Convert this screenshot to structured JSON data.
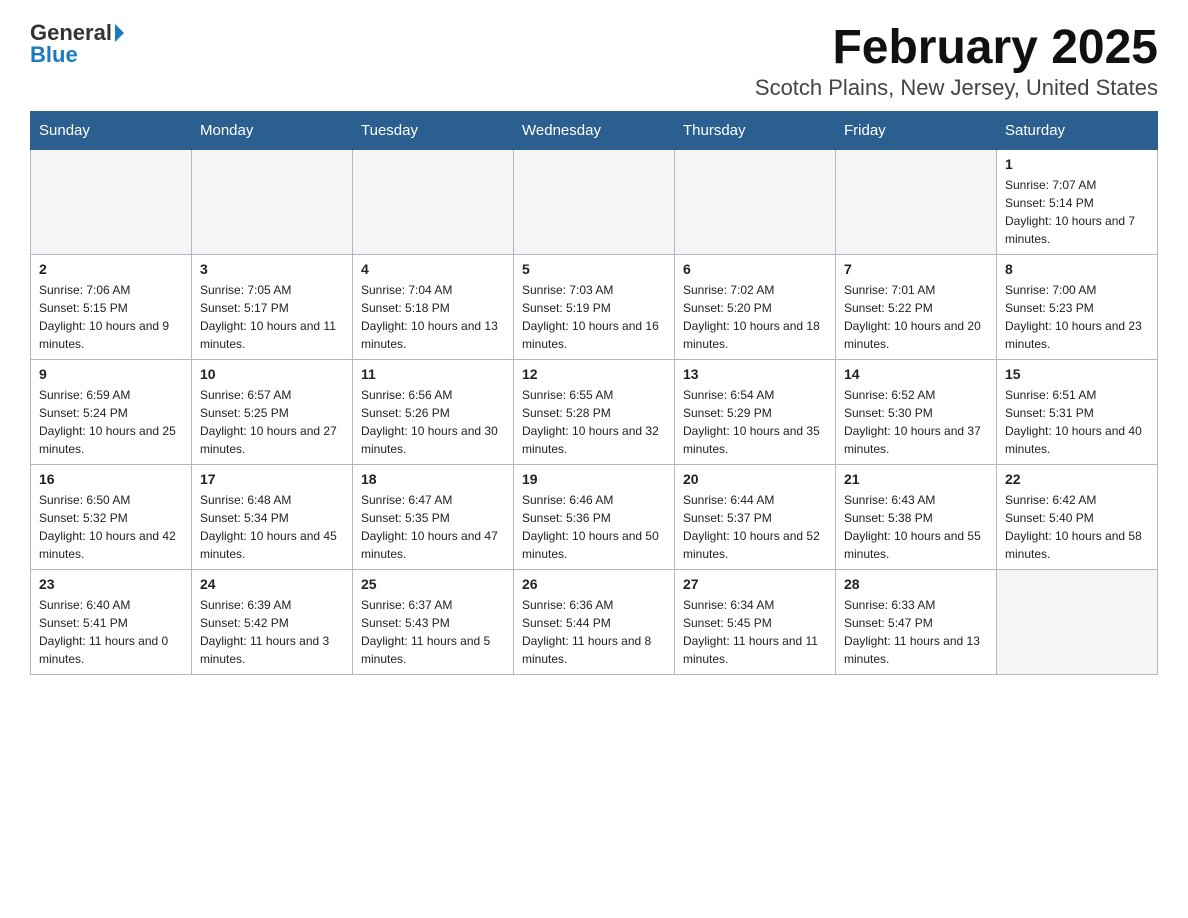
{
  "header": {
    "logo_general": "General",
    "logo_blue": "Blue",
    "main_title": "February 2025",
    "subtitle": "Scotch Plains, New Jersey, United States"
  },
  "days_of_week": [
    "Sunday",
    "Monday",
    "Tuesday",
    "Wednesday",
    "Thursday",
    "Friday",
    "Saturday"
  ],
  "weeks": [
    [
      {
        "day": "",
        "info": ""
      },
      {
        "day": "",
        "info": ""
      },
      {
        "day": "",
        "info": ""
      },
      {
        "day": "",
        "info": ""
      },
      {
        "day": "",
        "info": ""
      },
      {
        "day": "",
        "info": ""
      },
      {
        "day": "1",
        "info": "Sunrise: 7:07 AM\nSunset: 5:14 PM\nDaylight: 10 hours and 7 minutes."
      }
    ],
    [
      {
        "day": "2",
        "info": "Sunrise: 7:06 AM\nSunset: 5:15 PM\nDaylight: 10 hours and 9 minutes."
      },
      {
        "day": "3",
        "info": "Sunrise: 7:05 AM\nSunset: 5:17 PM\nDaylight: 10 hours and 11 minutes."
      },
      {
        "day": "4",
        "info": "Sunrise: 7:04 AM\nSunset: 5:18 PM\nDaylight: 10 hours and 13 minutes."
      },
      {
        "day": "5",
        "info": "Sunrise: 7:03 AM\nSunset: 5:19 PM\nDaylight: 10 hours and 16 minutes."
      },
      {
        "day": "6",
        "info": "Sunrise: 7:02 AM\nSunset: 5:20 PM\nDaylight: 10 hours and 18 minutes."
      },
      {
        "day": "7",
        "info": "Sunrise: 7:01 AM\nSunset: 5:22 PM\nDaylight: 10 hours and 20 minutes."
      },
      {
        "day": "8",
        "info": "Sunrise: 7:00 AM\nSunset: 5:23 PM\nDaylight: 10 hours and 23 minutes."
      }
    ],
    [
      {
        "day": "9",
        "info": "Sunrise: 6:59 AM\nSunset: 5:24 PM\nDaylight: 10 hours and 25 minutes."
      },
      {
        "day": "10",
        "info": "Sunrise: 6:57 AM\nSunset: 5:25 PM\nDaylight: 10 hours and 27 minutes."
      },
      {
        "day": "11",
        "info": "Sunrise: 6:56 AM\nSunset: 5:26 PM\nDaylight: 10 hours and 30 minutes."
      },
      {
        "day": "12",
        "info": "Sunrise: 6:55 AM\nSunset: 5:28 PM\nDaylight: 10 hours and 32 minutes."
      },
      {
        "day": "13",
        "info": "Sunrise: 6:54 AM\nSunset: 5:29 PM\nDaylight: 10 hours and 35 minutes."
      },
      {
        "day": "14",
        "info": "Sunrise: 6:52 AM\nSunset: 5:30 PM\nDaylight: 10 hours and 37 minutes."
      },
      {
        "day": "15",
        "info": "Sunrise: 6:51 AM\nSunset: 5:31 PM\nDaylight: 10 hours and 40 minutes."
      }
    ],
    [
      {
        "day": "16",
        "info": "Sunrise: 6:50 AM\nSunset: 5:32 PM\nDaylight: 10 hours and 42 minutes."
      },
      {
        "day": "17",
        "info": "Sunrise: 6:48 AM\nSunset: 5:34 PM\nDaylight: 10 hours and 45 minutes."
      },
      {
        "day": "18",
        "info": "Sunrise: 6:47 AM\nSunset: 5:35 PM\nDaylight: 10 hours and 47 minutes."
      },
      {
        "day": "19",
        "info": "Sunrise: 6:46 AM\nSunset: 5:36 PM\nDaylight: 10 hours and 50 minutes."
      },
      {
        "day": "20",
        "info": "Sunrise: 6:44 AM\nSunset: 5:37 PM\nDaylight: 10 hours and 52 minutes."
      },
      {
        "day": "21",
        "info": "Sunrise: 6:43 AM\nSunset: 5:38 PM\nDaylight: 10 hours and 55 minutes."
      },
      {
        "day": "22",
        "info": "Sunrise: 6:42 AM\nSunset: 5:40 PM\nDaylight: 10 hours and 58 minutes."
      }
    ],
    [
      {
        "day": "23",
        "info": "Sunrise: 6:40 AM\nSunset: 5:41 PM\nDaylight: 11 hours and 0 minutes."
      },
      {
        "day": "24",
        "info": "Sunrise: 6:39 AM\nSunset: 5:42 PM\nDaylight: 11 hours and 3 minutes."
      },
      {
        "day": "25",
        "info": "Sunrise: 6:37 AM\nSunset: 5:43 PM\nDaylight: 11 hours and 5 minutes."
      },
      {
        "day": "26",
        "info": "Sunrise: 6:36 AM\nSunset: 5:44 PM\nDaylight: 11 hours and 8 minutes."
      },
      {
        "day": "27",
        "info": "Sunrise: 6:34 AM\nSunset: 5:45 PM\nDaylight: 11 hours and 11 minutes."
      },
      {
        "day": "28",
        "info": "Sunrise: 6:33 AM\nSunset: 5:47 PM\nDaylight: 11 hours and 13 minutes."
      },
      {
        "day": "",
        "info": ""
      }
    ]
  ]
}
